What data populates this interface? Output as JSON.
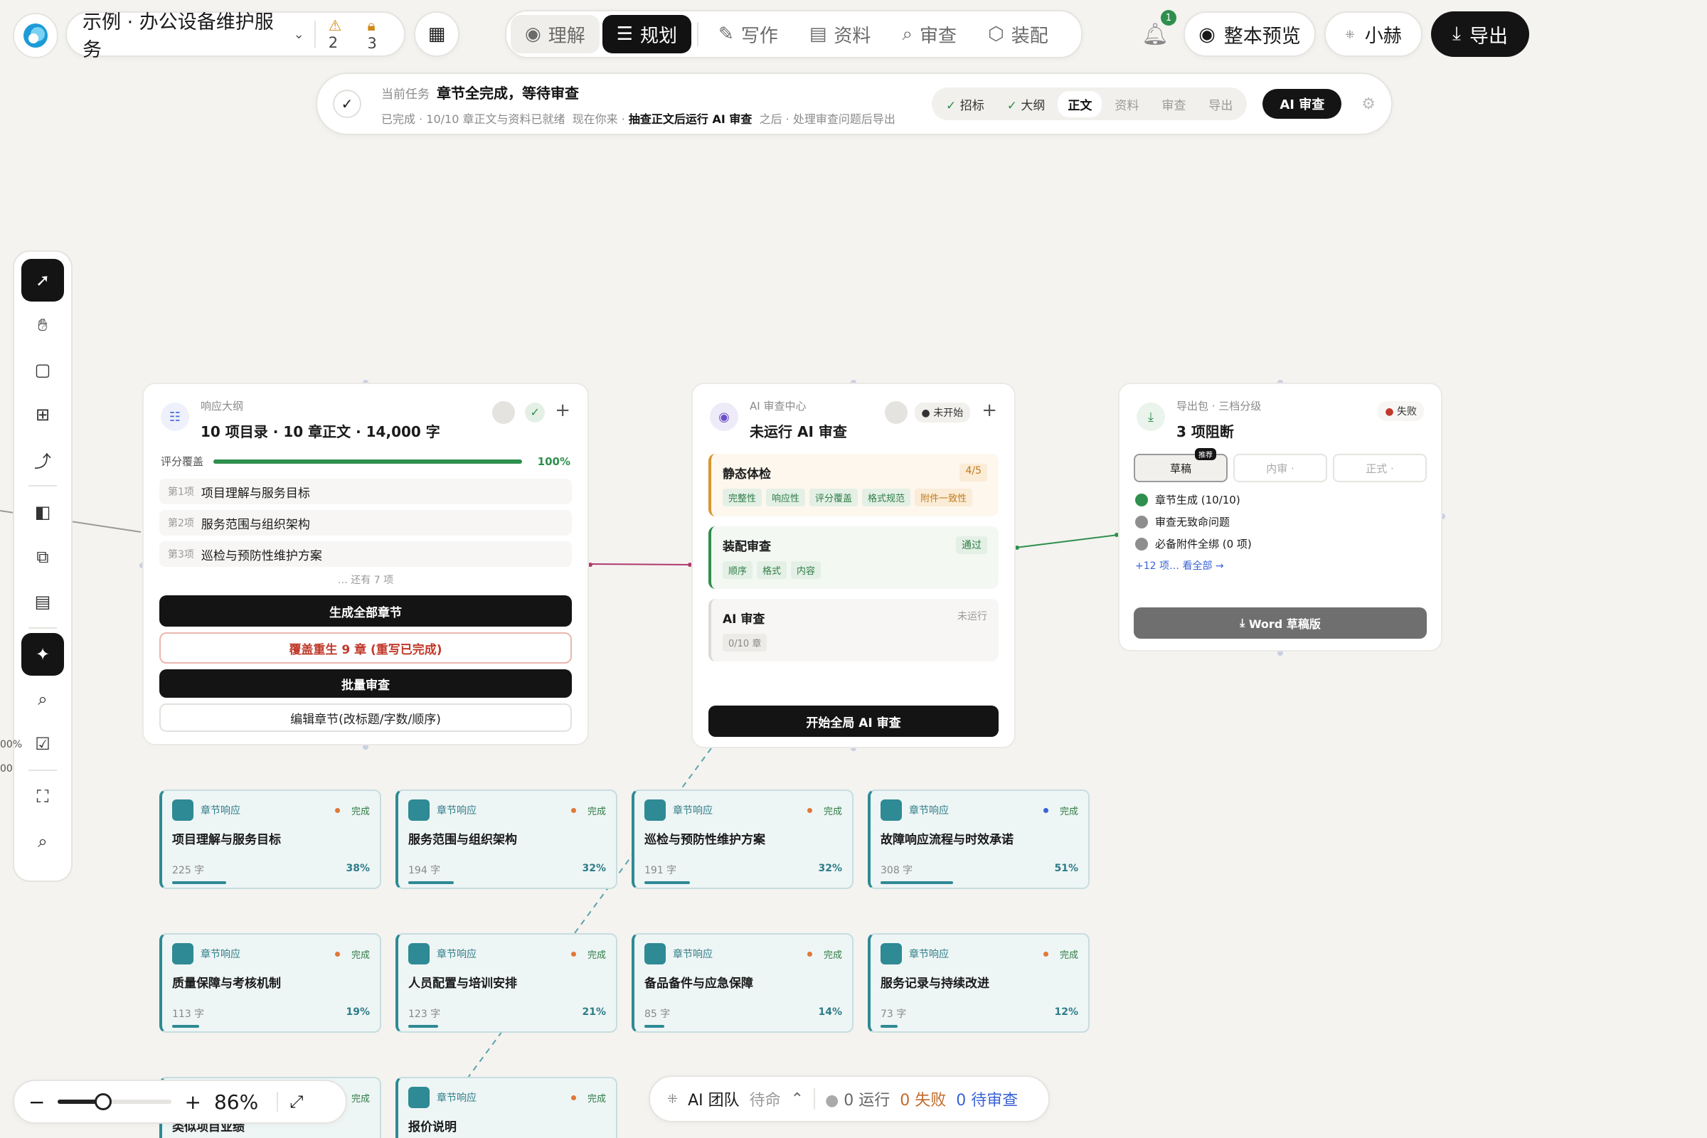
{
  "header": {
    "project": "示例 · 办公设备维护服务",
    "warn_count": "2",
    "lock_count": "3",
    "tabs": [
      "理解",
      "规划",
      "写作",
      "资料",
      "审查",
      "装配"
    ],
    "active_tab": "规划",
    "notif_count": "1",
    "preview": "整本预览",
    "user": "小赫",
    "export": "导出"
  },
  "task": {
    "label": "当前任务",
    "title": "章节全完成，等待审查",
    "done": "已完成 · 10/10 章正文与资料已就绪",
    "now_label": "现在你来 ·",
    "now": "抽查正文后运行 AI 审查",
    "after": "之后 · 处理审查问题后导出",
    "steps": [
      "招标",
      "大纲",
      "正文",
      "资料",
      "审查",
      "导出"
    ],
    "button": "AI 审查"
  },
  "outline": {
    "sub": "响应大纲",
    "title": "10 项目录 · 10 章正文 · 14,000 字",
    "cov_label": "评分覆盖",
    "cov_value": "100%",
    "cov_fraction": 1.0,
    "items": [
      {
        "idx": "第1项",
        "name": "项目理解与服务目标"
      },
      {
        "idx": "第2项",
        "name": "服务范围与组织架构"
      },
      {
        "idx": "第3项",
        "name": "巡检与预防性维护方案"
      }
    ],
    "more": "… 还有 7 项",
    "b1": "生成全部章节",
    "b2": "覆盖重生 9 章 (重写已完成)",
    "b3": "批量审查",
    "b4": "编辑章节(改标题/字数/顺序)"
  },
  "review": {
    "sub": "AI 审查中心",
    "title": "未运行 AI 审查",
    "status": "未开始",
    "s1": {
      "name": "静态体检",
      "score": "4/5",
      "tags": [
        "完整性",
        "响应性",
        "评分覆盖",
        "格式规范",
        "附件一致性"
      ]
    },
    "s2": {
      "name": "装配审查",
      "score": "通过",
      "tags": [
        "顺序",
        "格式",
        "内容"
      ]
    },
    "s3": {
      "name": "AI 审查",
      "score": "未运行",
      "tags": [
        "0/10 章"
      ]
    },
    "button": "开始全局 AI 审查"
  },
  "exportpkg": {
    "sub": "导出包 · 三档分级",
    "title": "3 项阻断",
    "status": "失败",
    "tabs": [
      "草稿",
      "内审 ·",
      "正式 ·"
    ],
    "rec": "推荐",
    "checks": [
      {
        "text": "章节生成 (10/10)",
        "ok": true
      },
      {
        "text": "审查无致命问题",
        "ok": false
      },
      {
        "text": "必备附件全绑 (0 项)",
        "ok": false
      }
    ],
    "more": "+12 项… 看全部 →",
    "button": "Word 草稿版"
  },
  "chapter_label": "章节响应",
  "chapter_status": "完成",
  "chapters": [
    {
      "name": "项目理解与服务目标",
      "words": "225 字",
      "pct": "38%",
      "p": 0.38
    },
    {
      "name": "服务范围与组织架构",
      "words": "194 字",
      "pct": "32%",
      "p": 0.32
    },
    {
      "name": "巡检与预防性维护方案",
      "words": "191 字",
      "pct": "32%",
      "p": 0.32
    },
    {
      "name": "故障响应流程与时效承诺",
      "words": "308 字",
      "pct": "51%",
      "p": 0.51
    },
    {
      "name": "质量保障与考核机制",
      "words": "113 字",
      "pct": "19%",
      "p": 0.19
    },
    {
      "name": "人员配置与培训安排",
      "words": "123 字",
      "pct": "21%",
      "p": 0.21
    },
    {
      "name": "备品备件与应急保障",
      "words": "85 字",
      "pct": "14%",
      "p": 0.14
    },
    {
      "name": "服务记录与持续改进",
      "words": "73 字",
      "pct": "12%",
      "p": 0.12
    },
    {
      "name": "类似项目业绩",
      "words": "",
      "pct": "",
      "p": 0
    },
    {
      "name": "报价说明",
      "words": "",
      "pct": "",
      "p": 0
    }
  ],
  "zoom": {
    "value": "86%",
    "level": 0.4
  },
  "team": {
    "name": "AI 团队",
    "state": "待命",
    "running": "0 运行",
    "failed": "0 失败",
    "pending": "0 待审查"
  },
  "side_partial": [
    "00%",
    "00"
  ]
}
